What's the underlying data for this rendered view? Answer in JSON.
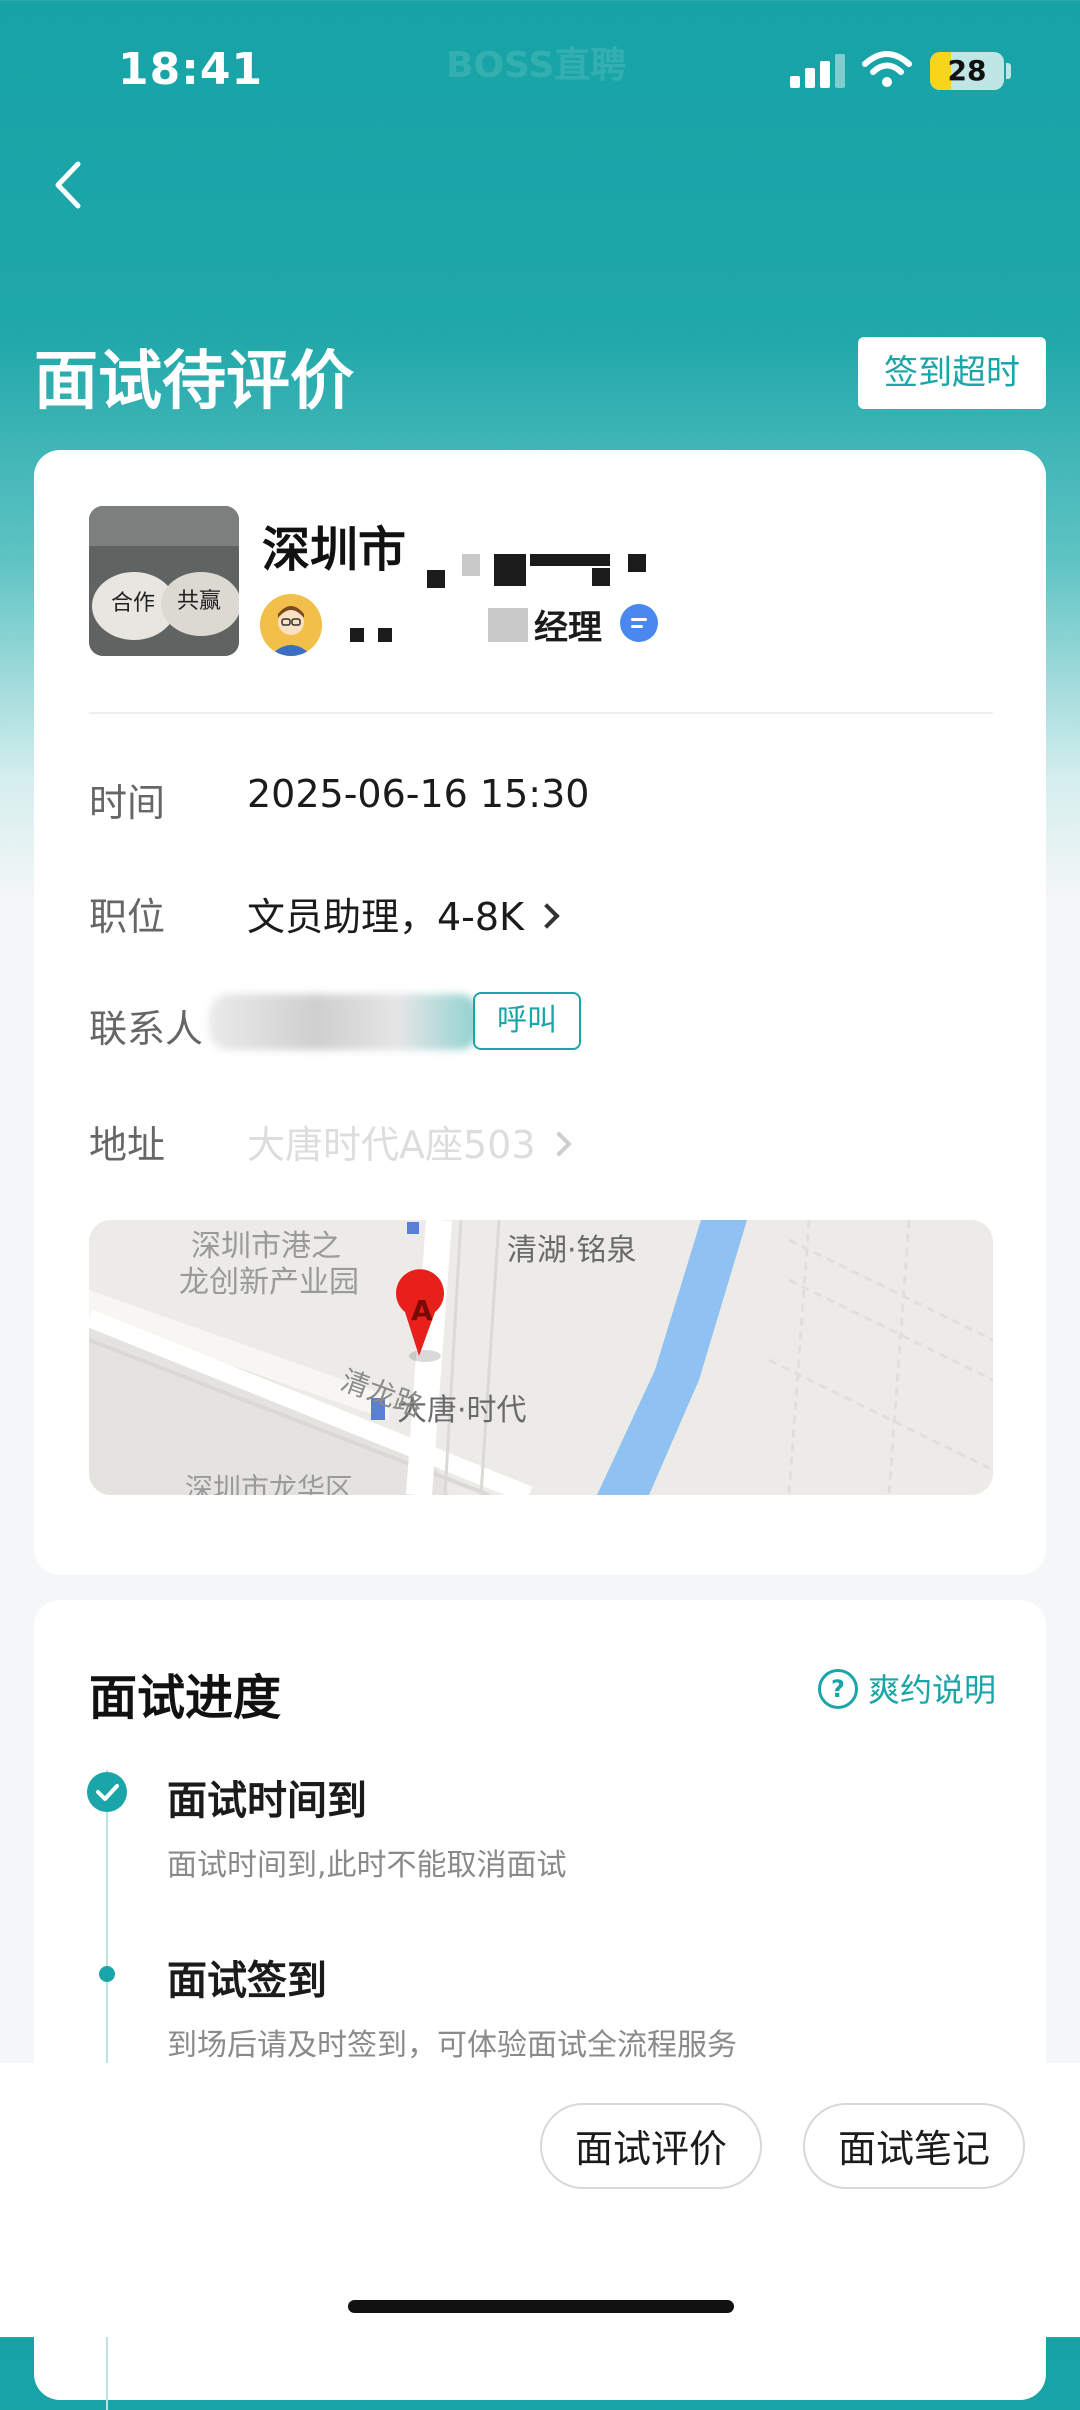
{
  "status_bar": {
    "time": "18:41",
    "watermark": "BOSS直聘",
    "battery": "28",
    "battery_level": 0.28
  },
  "header": {
    "title": "面试待评价",
    "badge": "签到超时"
  },
  "company": {
    "name": "深圳市",
    "hr_title": "经理"
  },
  "details": {
    "time_label": "时间",
    "time_value": "2025-06-16 15:30",
    "position_label": "职位",
    "position_value": "文员助理，4-8K",
    "contact_label": "联系人",
    "call_label": "呼叫",
    "address_label": "地址",
    "address_value": "大唐时代A座503"
  },
  "map": {
    "labels": [
      "深圳市港之",
      "龙创新产业园",
      "清湖·铭泉",
      "大唐·时代",
      "清龙路",
      "深圳市龙华区"
    ],
    "marker": "A"
  },
  "progress": {
    "title": "面试进度",
    "explain": "爽约说明",
    "steps": [
      {
        "title": "面试时间到",
        "desc": "面试时间到,此时不能取消面试"
      },
      {
        "title": "面试签到",
        "desc": "到场后请及时签到，可体验面试全流程服务"
      }
    ]
  },
  "actions": {
    "review": "面试评价",
    "notes": "面试笔记"
  },
  "colors": {
    "accent": "#1aa5a8",
    "chat_blue": "#4a88f0",
    "marker_red": "#e8201c"
  }
}
